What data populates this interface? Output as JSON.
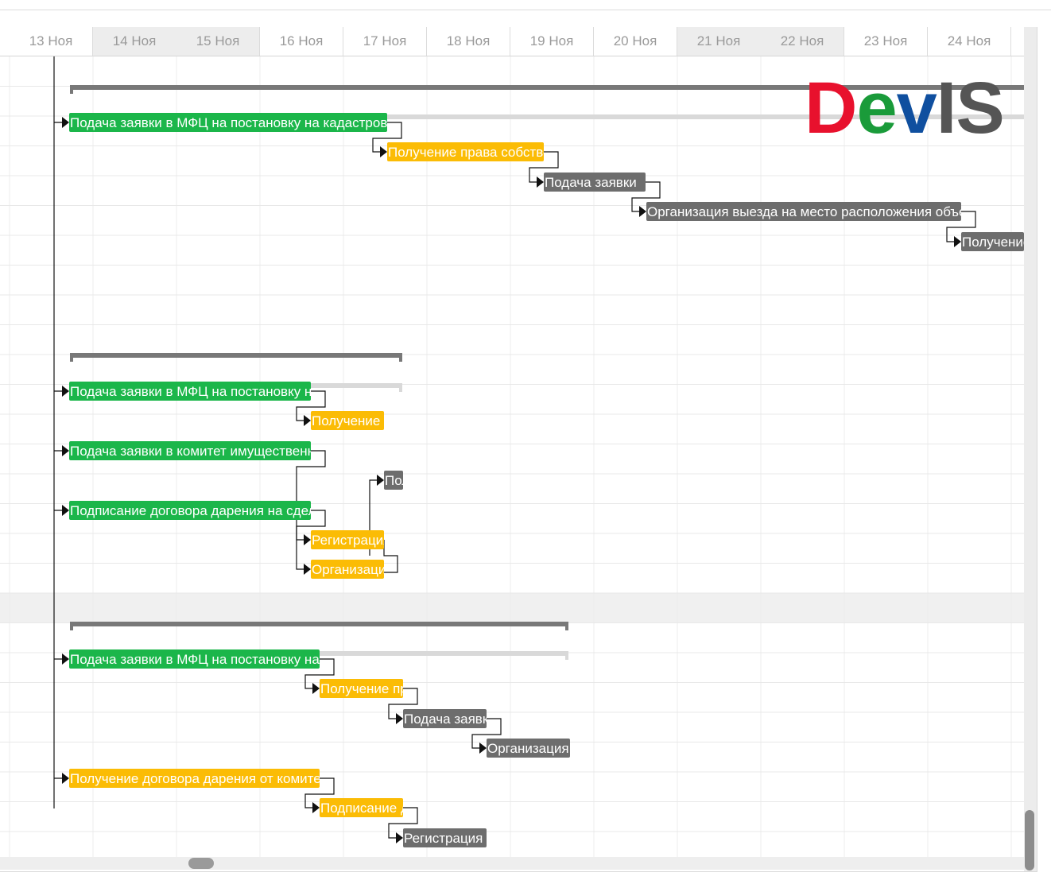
{
  "timeline": {
    "days": [
      "13 Ноя",
      "14 Ноя",
      "15 Ноя",
      "16 Ноя",
      "17 Ноя",
      "18 Ноя",
      "19 Ноя",
      "20 Ноя",
      "21 Ноя",
      "22 Ноя",
      "23 Ноя",
      "24 Ноя"
    ],
    "weekend_indices": [
      1,
      2,
      8,
      9
    ]
  },
  "logo": {
    "letters": [
      "D",
      "e",
      "v",
      "I",
      "S"
    ],
    "colors": [
      "#e8112d",
      "#1a9b3a",
      "#0f4f9f",
      "#555555",
      "#555555"
    ]
  },
  "colors": {
    "green": "#1bb64a",
    "yellow": "#fbbc05",
    "gray": "#6d6d6d",
    "summary": "#787878",
    "summary_light": "#d9d9d9"
  },
  "tasks": [
    {
      "text": "Подача заявки в МФЦ на постановку на кадастровый учет",
      "color": "green"
    },
    {
      "text": "Получение права собственности",
      "color": "yellow"
    },
    {
      "text": "Подача заявки",
      "color": "gray"
    },
    {
      "text": "Организация выезда на место расположения объекта",
      "color": "gray"
    },
    {
      "text": "Получение",
      "color": "gray"
    },
    {
      "text": "Подача заявки в МФЦ на постановку на кадастровый учет",
      "color": "green"
    },
    {
      "text": "Получение права собственности",
      "color": "yellow"
    },
    {
      "text": "Подача заявки в комитет имущественных отношений",
      "color": "green"
    },
    {
      "text": "Получение",
      "color": "gray"
    },
    {
      "text": "Подписание договора дарения на сделку",
      "color": "green"
    },
    {
      "text": "Регистрация права",
      "color": "yellow"
    },
    {
      "text": "Организация выезда",
      "color": "yellow"
    },
    {
      "text": "Подача заявки в МФЦ на постановку на кадастровый учет",
      "color": "green"
    },
    {
      "text": "Получение права собственности",
      "color": "yellow"
    },
    {
      "text": "Подача заявки",
      "color": "gray"
    },
    {
      "text": "Организация выезда",
      "color": "gray"
    },
    {
      "text": "Получение договора дарения от комитета",
      "color": "yellow"
    },
    {
      "text": "Подписание договора",
      "color": "yellow"
    },
    {
      "text": "Регистрация права",
      "color": "gray"
    }
  ]
}
